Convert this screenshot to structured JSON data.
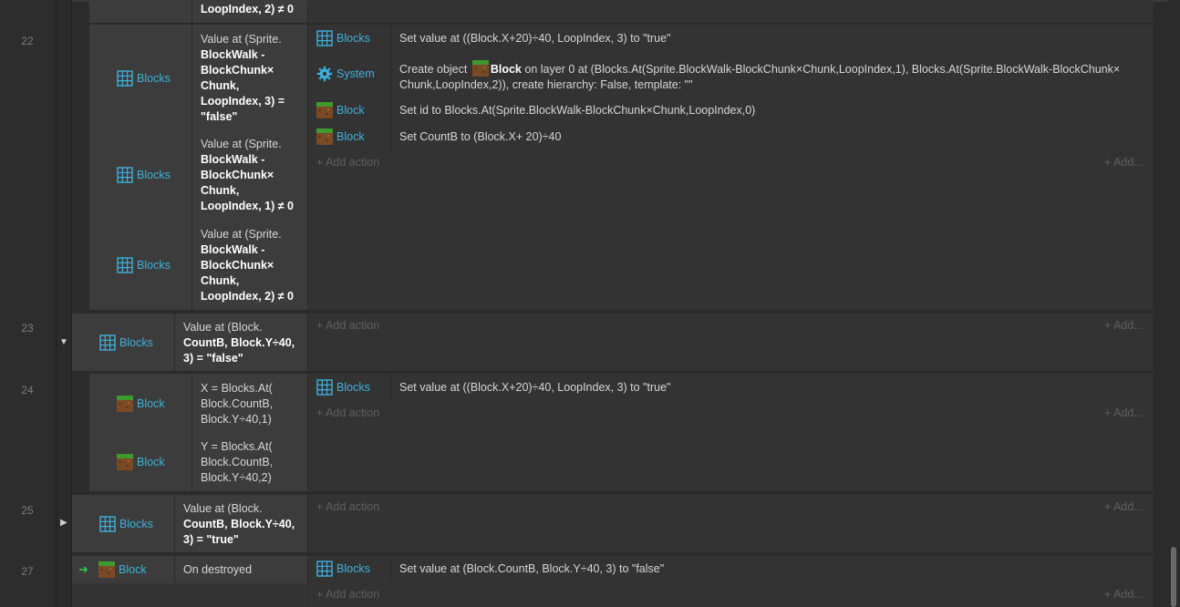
{
  "line_numbers": [
    "22",
    "23",
    "24",
    "25",
    "27"
  ],
  "add_action_label": "+ Add action",
  "add_right_label": "+ Add...",
  "top_partial": {
    "text_line": "LoopIndex, 2) ≠ 0"
  },
  "event22": {
    "conditions": [
      {
        "object": "Blocks",
        "lines": [
          "Value at (Sprite.",
          "BlockWalk -",
          "BlockChunk×",
          "Chunk,",
          "LoopIndex, 3) =",
          "\"false\""
        ]
      },
      {
        "object": "Blocks",
        "lines": [
          "Value at (Sprite.",
          "BlockWalk -",
          "BlockChunk×",
          "Chunk,",
          "LoopIndex, 1) ≠ 0"
        ]
      },
      {
        "object": "Blocks",
        "lines": [
          "Value at (Sprite.",
          "BlockWalk -",
          "BlockChunk×",
          "Chunk,",
          "LoopIndex, 2) ≠ 0"
        ]
      }
    ],
    "actions": [
      {
        "object": "Blocks",
        "text": "Set value at ((Block.X+20)÷40, LoopIndex, 3) to \"true\""
      },
      {
        "object": "System",
        "text1": "Create object",
        "text_obj": "Block",
        "text2": "on layer 0 at (Blocks.At(Sprite.BlockWalk-BlockChunk×Chunk,LoopIndex,1), Blocks.At(Sprite.BlockWalk-BlockChunk×",
        "text3": "Chunk,LoopIndex,2)), create hierarchy: False, template: \"\""
      },
      {
        "object": "Block",
        "text": "Set id to Blocks.At(Sprite.BlockWalk-BlockChunk×Chunk,LoopIndex,0)"
      },
      {
        "object": "Block",
        "text": "Set CountB to (Block.X+ 20)÷40"
      }
    ]
  },
  "event23": {
    "conditions": [
      {
        "object": "Blocks",
        "lines": [
          "Value at (Block.",
          "CountB, Block.Y÷40,",
          "3) = \"false\""
        ]
      }
    ]
  },
  "event24": {
    "conditions": [
      {
        "object": "Block",
        "lines": [
          "X = Blocks.At(",
          "Block.CountB,",
          "Block.Y÷40,1)"
        ]
      },
      {
        "object": "Block",
        "lines": [
          "Y = Blocks.At(",
          "Block.CountB,",
          "Block.Y÷40,2)"
        ]
      }
    ],
    "actions": [
      {
        "object": "Blocks",
        "text": "Set value at ((Block.X+20)÷40, LoopIndex, 3) to \"true\""
      }
    ]
  },
  "event25": {
    "conditions": [
      {
        "object": "Blocks",
        "lines": [
          "Value at (Block.",
          "CountB, Block.Y÷40,",
          "3) = \"true\""
        ]
      }
    ]
  },
  "event27": {
    "conditions": [
      {
        "object": "Block",
        "lines": [
          "On destroyed"
        ]
      }
    ],
    "actions": [
      {
        "object": "Blocks",
        "text": "Set value at (Block.CountB, Block.Y÷40, 3) to \"false\""
      }
    ]
  },
  "colors": {
    "object_name": "#3fb1dd",
    "trigger_arrow": "#36c24a"
  },
  "icons": {
    "array": "grid-icon",
    "system": "gear-icon",
    "sprite": "dirt-block-icon",
    "collapse": "triangle-down-icon",
    "expand": "triangle-right-icon",
    "trigger": "arrow-right-icon"
  }
}
